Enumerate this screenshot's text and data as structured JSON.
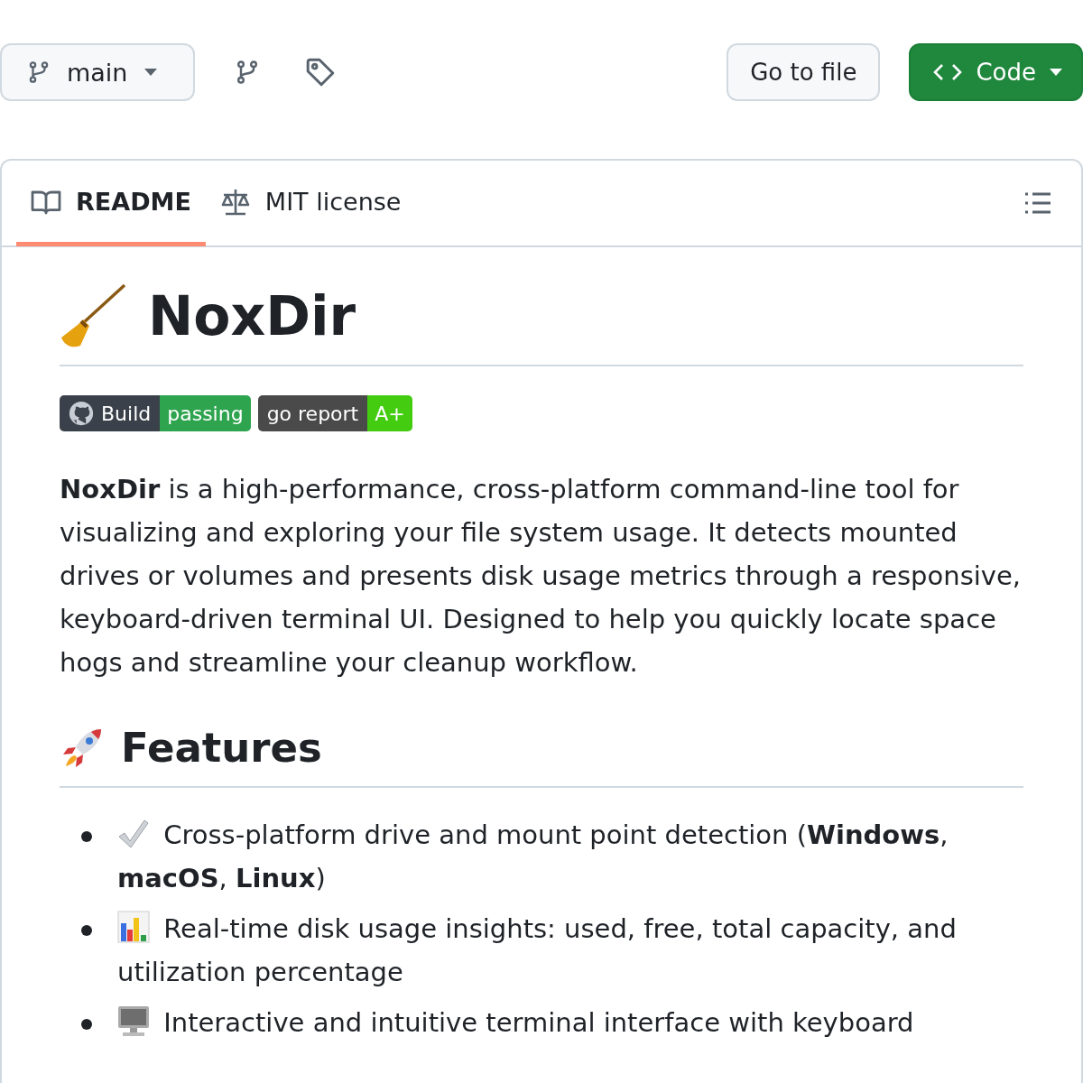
{
  "branch": {
    "label": "main"
  },
  "toolbar": {
    "go_to_file": "Go to file",
    "code": "Code"
  },
  "tabs": [
    {
      "label": "README",
      "kind": "book",
      "selected": true
    },
    {
      "label": "MIT license",
      "kind": "scale",
      "selected": false
    }
  ],
  "readme": {
    "title": "NoxDir",
    "badges": [
      {
        "label": "Build",
        "value": "passing",
        "kind": "github",
        "color": "#2ea44f"
      },
      {
        "label": "go report",
        "value": "A+",
        "kind": "plain",
        "color": "#44cc11"
      }
    ],
    "intro": "**NoxDir** is a high-performance, cross-platform command-line tool for visualizing and exploring your file system usage. It detects mounted drives or volumes and presents disk usage metrics through a responsive, keyboard-driven terminal UI. Designed to help you quickly locate space hogs and streamline your cleanup workflow.",
    "features_heading": "Features",
    "features": [
      {
        "kind": "check",
        "text": "Cross-platform drive and mount point detection (**Windows**, **macOS**, **Linux**)"
      },
      {
        "kind": "chart",
        "text": "Real-time disk usage insights: used, free, total capacity, and utilization percentage"
      },
      {
        "kind": "computer",
        "text": "Interactive and intuitive terminal interface with keyboard"
      }
    ]
  }
}
